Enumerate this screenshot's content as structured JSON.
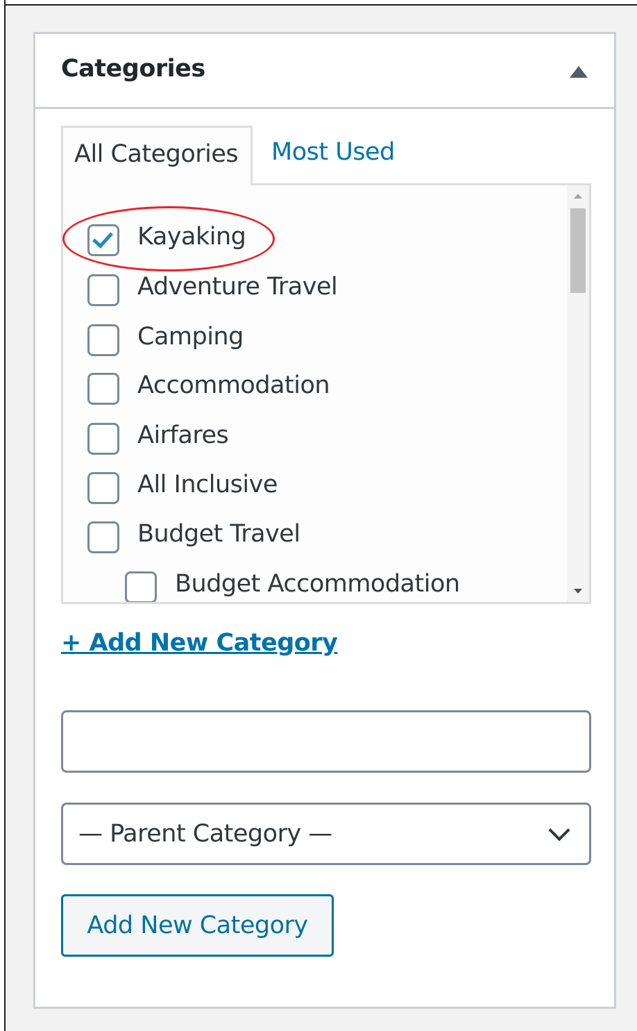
{
  "postbox": {
    "title": "Categories",
    "toggle_icon": "triangle-up-icon"
  },
  "tabs": [
    {
      "label": "All Categories",
      "active": true
    },
    {
      "label": "Most Used",
      "active": false
    }
  ],
  "categories": [
    {
      "label": "Kayaking",
      "checked": true,
      "level": 0
    },
    {
      "label": "Adventure Travel",
      "checked": false,
      "level": 0
    },
    {
      "label": "Camping",
      "checked": false,
      "level": 0
    },
    {
      "label": "Accommodation",
      "checked": false,
      "level": 0
    },
    {
      "label": "Airfares",
      "checked": false,
      "level": 0
    },
    {
      "label": "All Inclusive",
      "checked": false,
      "level": 0
    },
    {
      "label": "Budget Travel",
      "checked": false,
      "level": 0
    },
    {
      "label": "Budget Accommodation",
      "checked": false,
      "level": 1
    }
  ],
  "add_new": {
    "link_label": "+ Add New Category",
    "input_value": "",
    "parent_select_value": "— Parent Category —",
    "button_label": "Add New Category"
  },
  "colors": {
    "link": "#0073aa",
    "highlight": "#e8222a",
    "check": "#1e8cbe"
  }
}
